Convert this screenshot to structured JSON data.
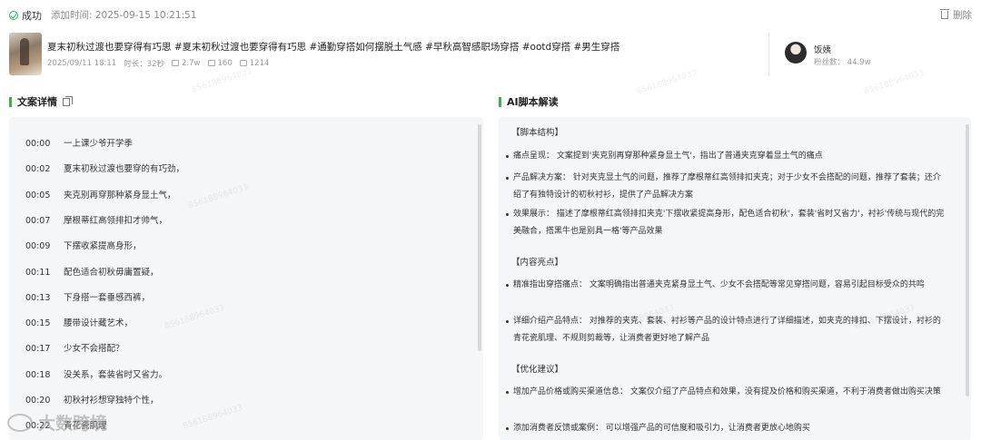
{
  "header": {
    "status": "成功",
    "added_time": "添加时间: 2025-09-15 10:21:51",
    "delete_label": "删除"
  },
  "video": {
    "title": "夏末初秋过渡也要穿得有巧思 #夏末初秋过渡也要穿得有巧思 #通勤穿搭如何摆脱土气感 #早秋高智感职场穿搭 #ootd穿搭 #男生穿搭",
    "date": "2025/09/11 18:11",
    "duration": "时长：32秒",
    "likes": "2.7w",
    "comments": "160",
    "shares": "1214"
  },
  "author": {
    "name": "饭姨",
    "fans": "粉丝数： 44.9w"
  },
  "left_section": {
    "title": "文案详情",
    "lines": [
      {
        "time": "00:00",
        "text": "一上课少爷开学季"
      },
      {
        "time": "00:02",
        "text": "夏末初秋过渡也要穿的有巧劲，"
      },
      {
        "time": "00:05",
        "text": "夹克别再穿那种紧身显土气，"
      },
      {
        "time": "00:07",
        "text": "摩根蒂红高领排扣才帅气，"
      },
      {
        "time": "00:09",
        "text": "下摆收紧提高身形，"
      },
      {
        "time": "00:11",
        "text": "配色适合初秋毋庸置疑，"
      },
      {
        "time": "00:13",
        "text": "下身搭一套垂感西裤，"
      },
      {
        "time": "00:15",
        "text": "腰带设计藏艺术，"
      },
      {
        "time": "00:17",
        "text": "少女不会搭配？"
      },
      {
        "time": "00:18",
        "text": "没关系，套装省时又省力。"
      },
      {
        "time": "00:20",
        "text": "初秋衬衫想穿独特个性，"
      },
      {
        "time": "00:22",
        "text": "青花瓷肌理"
      }
    ]
  },
  "right_section": {
    "title": "AI脚本解读",
    "structure_heading": "【脚本结构】",
    "structure": [
      "痛点呈现：  文案提到'夹克别再穿那种紧身显土气'，指出了普通夹克穿着显土气的痛点",
      "产品解决方案：  针对夹克显土气的问题，推荐了摩根蒂红高领排扣夹克；对于少女不会搭配的问题，推荐了套装；还介绍了有独特设计的初秋衬衫，提供了产品解决方案",
      "效果展示：  描述了摩根蒂红高领排扣夹克'下摆收紧提高身形，配色适合初秋'，套装'省时又省力'，衬衫'传统与现代的完美融合，搭黑牛也是别具一格'等产品效果"
    ],
    "highlights_heading": "【内容亮点】",
    "highlights": [
      "精准指出穿搭痛点：  文案明确指出普通夹克紧身显土气、少女不会搭配等常见穿搭问题，容易引起目标受众的共鸣",
      "详细介绍产品特点：  对推荐的夹克、套装、衬衫等产品的设计特点进行了详细描述，如夹克的排扣、下摆设计，衬衫的青花瓷肌理、不规则剪裁等，让消费者更好地了解产品"
    ],
    "suggestions_heading": "【优化建议】",
    "suggestions": [
      "增加产品价格或购买渠道信息：  文案仅介绍了产品特点和效果，没有提及价格和购买渠道，不利于消费者做出购买决策",
      "添加消费者反馈或案例：  可以增强产品的可信度和吸引力，让消费者更放心地购买"
    ]
  },
  "watermark": "856188964033",
  "brand": "大数跨境"
}
